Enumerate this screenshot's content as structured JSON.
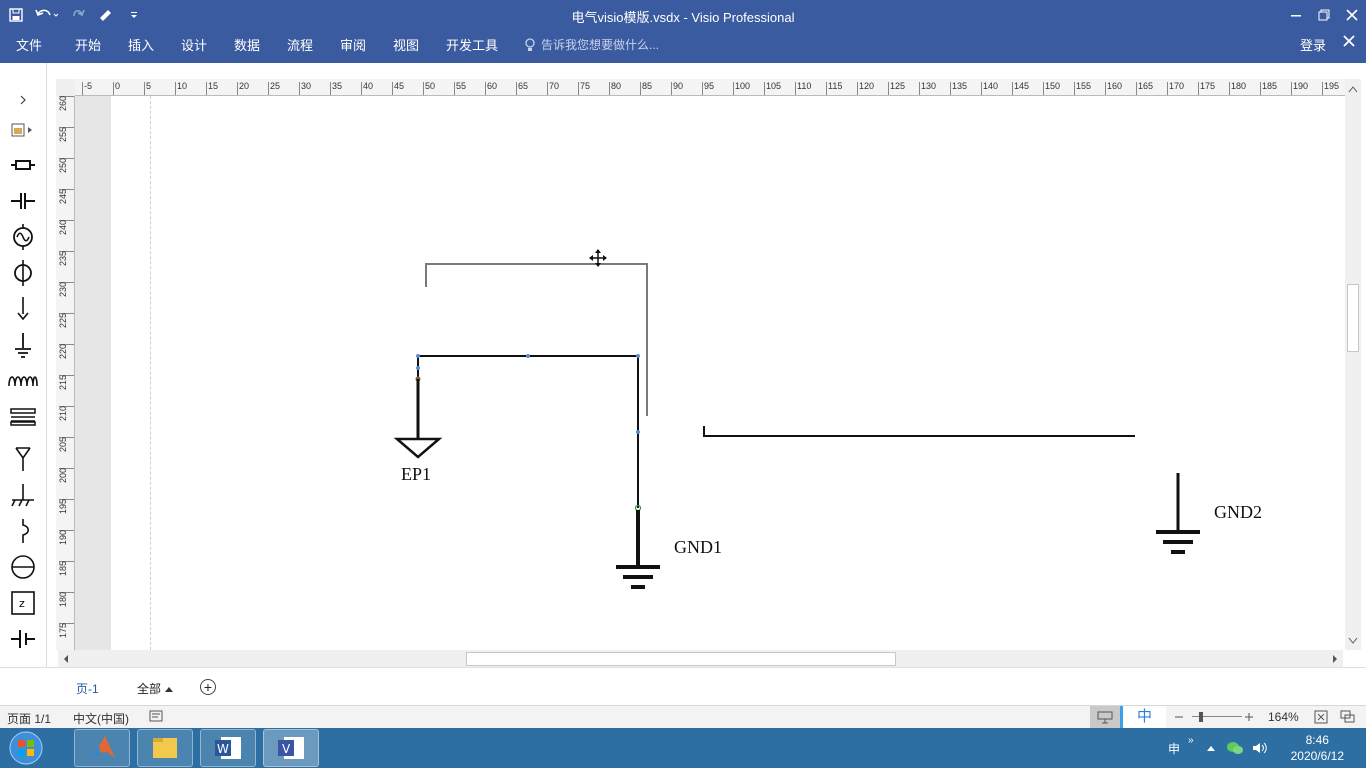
{
  "window": {
    "title": "电气visio模版.vsdx - Visio Professional"
  },
  "ribbon": {
    "tabs": [
      "文件",
      "开始",
      "插入",
      "设计",
      "数据",
      "流程",
      "审阅",
      "视图",
      "开发工具"
    ],
    "tell_me": "告诉我您想要做什么...",
    "login": "登录"
  },
  "rulers": {
    "horizontal": [
      "-5",
      "0",
      "5",
      "10",
      "15",
      "20",
      "25",
      "30",
      "35",
      "40",
      "45",
      "50",
      "55",
      "60",
      "65",
      "70",
      "75",
      "80",
      "85",
      "90",
      "95",
      "100",
      "105",
      "110",
      "115",
      "120",
      "125",
      "130",
      "135",
      "140",
      "145",
      "150",
      "155",
      "160",
      "165",
      "170",
      "175",
      "180",
      "185",
      "190",
      "195"
    ],
    "vertical": [
      "260",
      "255",
      "250",
      "245",
      "240",
      "235",
      "230",
      "225",
      "220",
      "215",
      "210",
      "205",
      "200",
      "195",
      "190",
      "185",
      "180",
      "175"
    ]
  },
  "drawing": {
    "labels": {
      "ep1": "EP1",
      "gnd1": "GND1",
      "gnd2": "GND2"
    }
  },
  "page_tabs": {
    "current": "页-1",
    "all": "全部"
  },
  "statusbar": {
    "page": "页面 1/1",
    "language": "中文(中国)",
    "ime": "中",
    "zoom": "164%"
  },
  "taskbar": {
    "ime_tray": "申",
    "time": "8:46",
    "date": "2020/6/12"
  },
  "colors": {
    "accent": "#3b5ba0",
    "taskbar": "#2d6fa3"
  }
}
